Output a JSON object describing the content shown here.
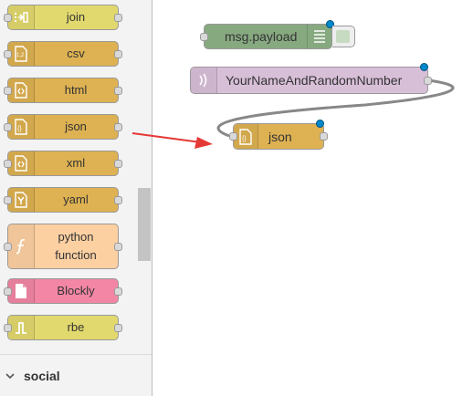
{
  "palette": {
    "nodes": [
      {
        "label": "join",
        "color": "#e2d96e",
        "icon": "join-icon"
      },
      {
        "label": "csv",
        "color": "#deb252",
        "icon": "csv-icon"
      },
      {
        "label": "html",
        "color": "#deb252",
        "icon": "html-icon"
      },
      {
        "label": "json",
        "color": "#deb252",
        "icon": "json-icon"
      },
      {
        "label": "xml",
        "color": "#deb252",
        "icon": "xml-icon"
      },
      {
        "label": "yaml",
        "color": "#deb252",
        "icon": "yaml-icon"
      },
      {
        "label": "python\nfunction",
        "color": "#fdd0a2",
        "icon": "function-icon"
      },
      {
        "label": "Blockly",
        "color": "#f386a5",
        "icon": "file-icon"
      },
      {
        "label": "rbe",
        "color": "#e2d96e",
        "icon": "rbe-icon"
      }
    ],
    "category": {
      "label": "social",
      "expanded": false
    }
  },
  "workspace": {
    "nodes": {
      "debug": {
        "label": "msg.payload",
        "color": "#87a980"
      },
      "inject": {
        "label": "YourNameAndRandomNumber",
        "color": "#d8bfd8"
      },
      "json": {
        "label": "json",
        "color": "#deb252"
      }
    },
    "annotation": {
      "type": "arrow",
      "color": "#e53935"
    }
  }
}
